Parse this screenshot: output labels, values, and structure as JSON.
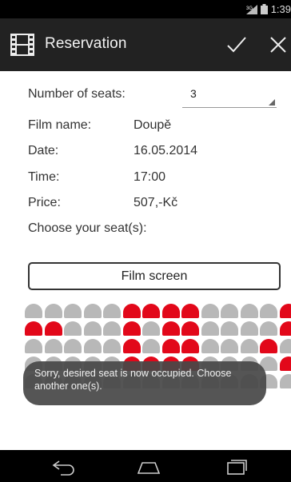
{
  "statusbar": {
    "time": "1:39",
    "network": "3G"
  },
  "actionbar": {
    "title": "Reservation",
    "icon": "film-strip-icon",
    "confirm_icon": "checkmark-icon",
    "close_icon": "close-icon"
  },
  "form": {
    "seats_label": "Number of seats:",
    "seats_value": "3",
    "film_label": "Film name:",
    "film_value": "Doupě",
    "date_label": "Date:",
    "date_value": "16.05.2014",
    "time_label": "Time:",
    "time_value": "17:00",
    "price_label": "Price:",
    "price_value": "507,-Kč",
    "choose_label": "Choose your seat(s):"
  },
  "screen_button": "Film screen",
  "seatmap": {
    "rows": [
      [
        "free",
        "free",
        "free",
        "free",
        "free",
        "occ",
        "occ",
        "occ",
        "occ",
        "free",
        "free",
        "free",
        "free",
        "occ"
      ],
      [
        "occ",
        "occ",
        "free",
        "free",
        "free",
        "occ",
        "free",
        "occ",
        "occ",
        "free",
        "free",
        "free",
        "free",
        "occ"
      ],
      [
        "free",
        "free",
        "free",
        "free",
        "free",
        "occ",
        "free",
        "occ",
        "occ",
        "free",
        "free",
        "free",
        "occ",
        "free"
      ],
      [
        "free",
        "free",
        "free",
        "free",
        "free",
        "occ",
        "occ",
        "occ",
        "occ",
        "free",
        "free",
        "free",
        "free",
        "occ"
      ],
      [
        "free",
        "free",
        "free",
        "free",
        "free",
        "free",
        "free",
        "free",
        "free",
        "free",
        "free",
        "free",
        "free",
        "free"
      ]
    ],
    "colors": {
      "free": "#b8b8b8",
      "occupied": "#e2081a"
    }
  },
  "toast": "Sorry, desired seat is now occupied. Choose another one(s).",
  "navbar": {
    "back": "back-icon",
    "home": "home-icon",
    "recents": "recents-icon"
  }
}
